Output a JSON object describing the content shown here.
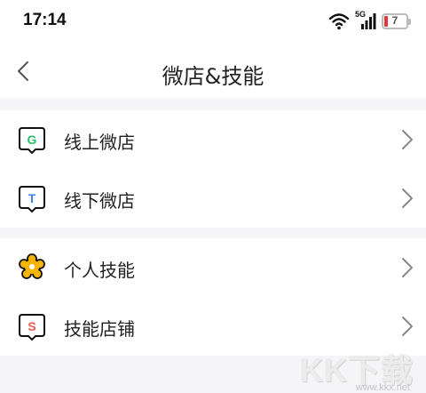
{
  "status_bar": {
    "time": "17:14",
    "network": "5G",
    "battery": "7",
    "icons": [
      "wifi-icon",
      "signal-icon",
      "battery-icon"
    ]
  },
  "nav": {
    "title": "微店&技能",
    "back_icon": "chevron-left-icon"
  },
  "groups": [
    {
      "items": [
        {
          "label": "线上微店",
          "icon_letter": "G",
          "icon_color": "#2bbf6a"
        },
        {
          "label": "线下微店",
          "icon_letter": "T",
          "icon_color": "#3b82f6"
        }
      ]
    },
    {
      "items": [
        {
          "label": "个人技能",
          "icon": "flower-icon",
          "icon_color": "#f5b400"
        },
        {
          "label": "技能店铺",
          "icon_letter": "S",
          "icon_color": "#f05a4f"
        }
      ]
    }
  ],
  "watermark": {
    "text": "KK下载",
    "url": "www.kkx.net"
  }
}
